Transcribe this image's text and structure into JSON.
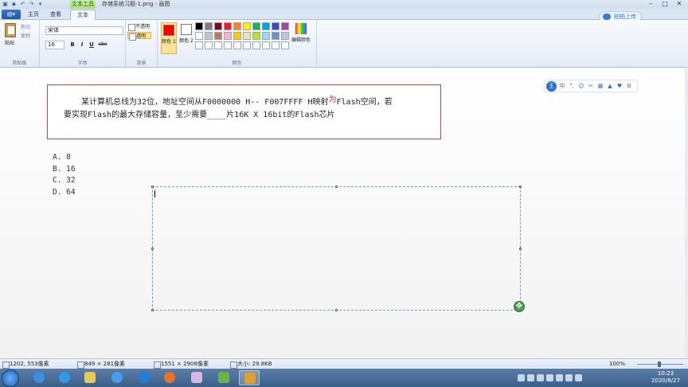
{
  "titlebar": {
    "title": "存储系统习题-1.png - 画图",
    "context_tab": "文本工具",
    "upload_button": "拍拍上传"
  },
  "tabs": {
    "file_label": "",
    "items": [
      "主页",
      "查看",
      "文本"
    ],
    "active": "文本"
  },
  "ribbon": {
    "clipboard": {
      "paste": "粘贴",
      "cut": "剪切",
      "copy": "复制",
      "group_label": "剪贴板"
    },
    "font": {
      "family": "宋体",
      "size": "16",
      "bold": "B",
      "italic": "I",
      "underline": "U",
      "strike": "abe",
      "group_label": "字体"
    },
    "background": {
      "opaque": "不透明",
      "transparent": "透明",
      "group_label": "背景"
    },
    "colors": {
      "color1_label": "颜色 1",
      "color1": "#ff0000",
      "color2_label": "颜色 2",
      "color2": "#ffffff",
      "edit_label": "编辑颜色",
      "group_label": "颜色",
      "palette": [
        "#000000",
        "#7f7f7f",
        "#880015",
        "#ed1c24",
        "#ff7f27",
        "#fff200",
        "#22b14c",
        "#00a2e8",
        "#3f48cc",
        "#a349a4",
        "#ffffff",
        "#c3c3c3",
        "#b97a57",
        "#ffaec9",
        "#ffc90e",
        "#efe4b0",
        "#b5e61d",
        "#99d9ea",
        "#7092be",
        "#c8bfe7",
        "#ffffff",
        "#ffffff",
        "#ffffff",
        "#ffffff",
        "#ffffff",
        "#ffffff",
        "#ffffff",
        "#ffffff",
        "#ffffff",
        "#ffffff"
      ]
    }
  },
  "question": {
    "line1_pre": "某计算机总线为32位，地址空间从F0000000 H-- F007FFFF H映射",
    "line1_red": "为",
    "line1_post": "Flash空间，若",
    "line2": "要实现Flash的最大存储容量，至少需要____片16K X 16bit的Flash芯片"
  },
  "options": [
    "A.  8",
    "B.  16",
    "C.  32",
    "D.  64"
  ],
  "ime": {
    "logo": "王",
    "mode": "中"
  },
  "statusbar": {
    "cursor": "1202, 553像素",
    "selection": "849 × 281像素",
    "image_size": "1551 × 2908像素",
    "file_size": "大小: 29.8KB",
    "zoom": "100%"
  },
  "taskbar": {
    "time": "10:23",
    "date": "2020/8/27"
  }
}
